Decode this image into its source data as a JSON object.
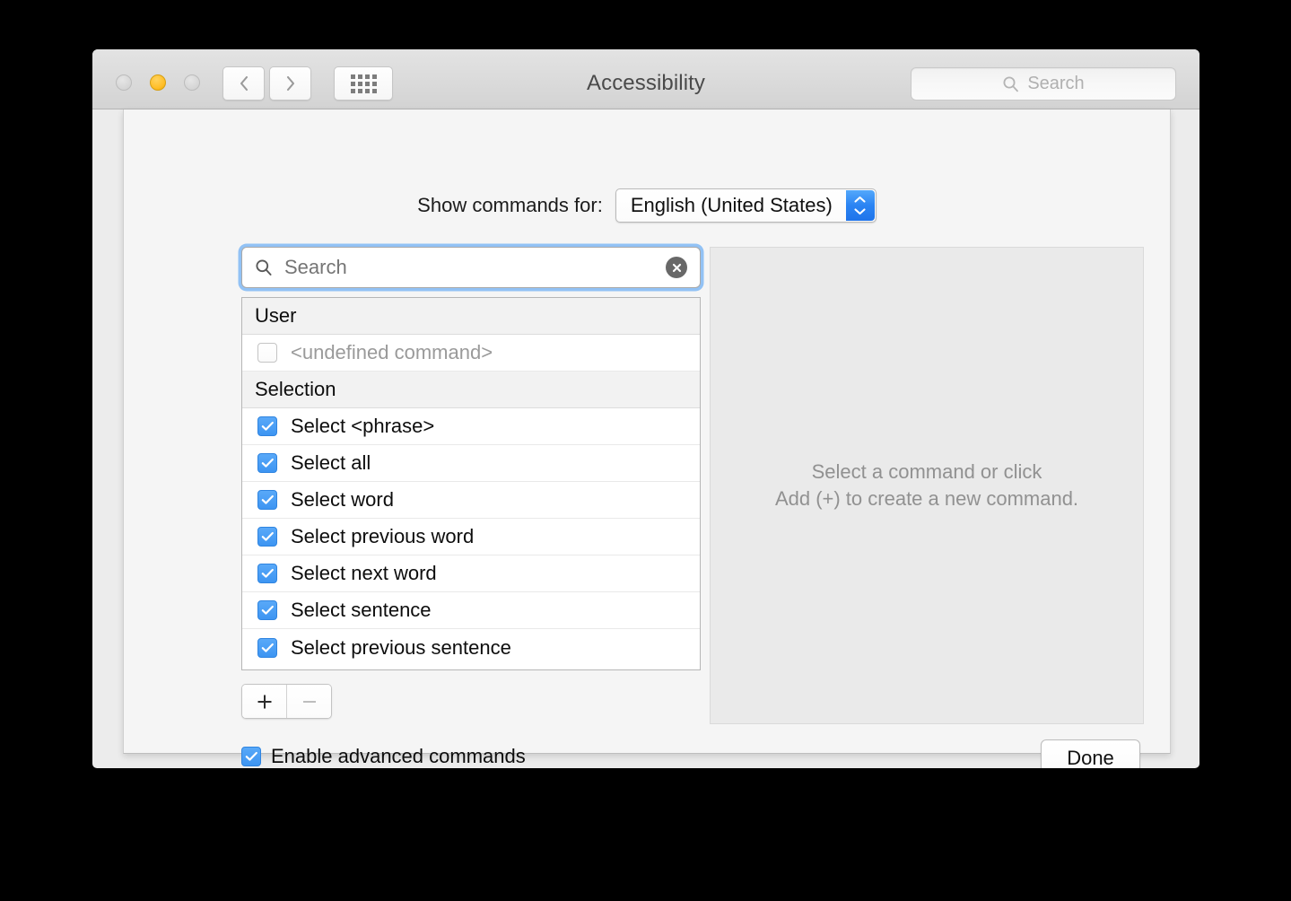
{
  "window": {
    "title": "Accessibility",
    "traffic_lights": [
      {
        "name": "close",
        "color": "#d5d5d5",
        "state": "inactive"
      },
      {
        "name": "minimize",
        "color": "#ffbe28",
        "state": "active"
      },
      {
        "name": "zoom",
        "color": "#d5d5d5",
        "state": "inactive"
      }
    ],
    "toolbar": {
      "back_icon": "chevron-left-icon",
      "forward_icon": "chevron-right-icon",
      "show_all_icon": "grid-icon",
      "search": {
        "placeholder": "Search",
        "icon": "search-icon",
        "value": ""
      }
    }
  },
  "sheet": {
    "language_row": {
      "label": "Show commands for:",
      "selected": "English (United States)",
      "options": [
        "English (United States)"
      ],
      "stepper_color": "#2b84f3"
    },
    "search": {
      "placeholder": "Search",
      "value": "",
      "icon": "search-icon",
      "clear_icon": "clear-circle-icon",
      "focused": true,
      "focus_ring_color": "#70b0f4"
    },
    "command_list": {
      "groups": [
        {
          "header": "User",
          "rows": [
            {
              "label": "<undefined command>",
              "checked": false,
              "dim": true
            }
          ]
        },
        {
          "header": "Selection",
          "rows": [
            {
              "label": "Select <phrase>",
              "checked": true,
              "dim": false
            },
            {
              "label": "Select all",
              "checked": true,
              "dim": false
            },
            {
              "label": "Select word",
              "checked": true,
              "dim": false
            },
            {
              "label": "Select previous word",
              "checked": true,
              "dim": false
            },
            {
              "label": "Select next word",
              "checked": true,
              "dim": false
            },
            {
              "label": "Select sentence",
              "checked": true,
              "dim": false
            },
            {
              "label": "Select previous sentence",
              "checked": true,
              "dim": false
            }
          ]
        }
      ],
      "checkbox_color": "#3d95f2"
    },
    "segmented_controls": [
      {
        "name": "add",
        "glyph": "+",
        "enabled": true
      },
      {
        "name": "remove",
        "glyph": "—",
        "enabled": false
      }
    ],
    "detail_pane": {
      "line1": "Select a command or click",
      "line2": "Add (+) to create a new command."
    },
    "footer": {
      "advanced_checkbox": {
        "label": "Enable advanced commands",
        "checked": true
      },
      "done_button": "Done"
    }
  }
}
